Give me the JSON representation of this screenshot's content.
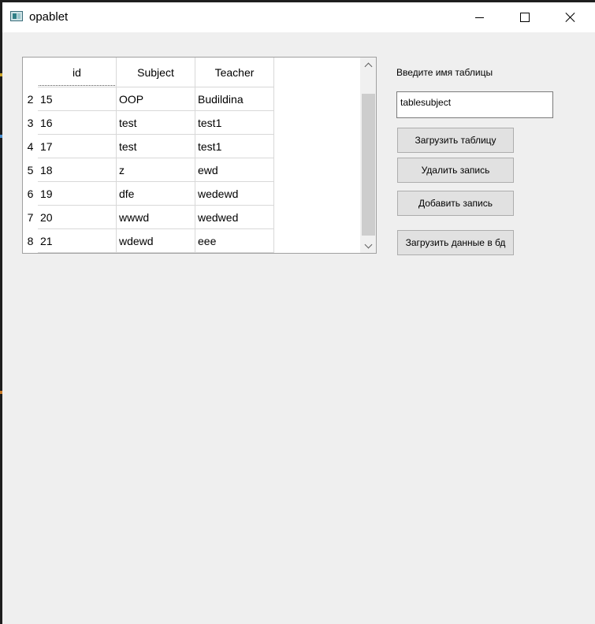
{
  "window": {
    "title": "opablet",
    "icon": "app-window-icon",
    "controls": {
      "minimize": "minimize-icon",
      "maximize": "maximize-icon",
      "close": "close-icon"
    }
  },
  "table": {
    "columns": [
      "id",
      "Subject",
      "Teacher"
    ],
    "rows": [
      {
        "num": "2",
        "cells": [
          "15",
          "OOP",
          "Budildina"
        ]
      },
      {
        "num": "3",
        "cells": [
          "16",
          "test",
          "test1"
        ]
      },
      {
        "num": "4",
        "cells": [
          "17",
          "test",
          "test1"
        ]
      },
      {
        "num": "5",
        "cells": [
          "18",
          "z",
          "ewd"
        ]
      },
      {
        "num": "6",
        "cells": [
          "19",
          "dfe",
          "wedewd"
        ]
      },
      {
        "num": "7",
        "cells": [
          "20",
          "wwwd",
          "wedwed"
        ]
      },
      {
        "num": "8",
        "cells": [
          "21",
          "wdewd",
          "eee"
        ]
      }
    ]
  },
  "form": {
    "label": "Введите имя таблицы",
    "input_value": "tablesubject",
    "buttons": {
      "load_table": "Загрузить таблицу",
      "delete_record": "Удалить запись",
      "add_record": "Добавить запись",
      "upload_db": "Загрузить данные в бд"
    }
  },
  "colors": {
    "window_bg": "#efefef",
    "titlebar_bg": "#ffffff",
    "scroll_thumb": "#cdcdcd",
    "button_bg": "#e1e1e1"
  }
}
